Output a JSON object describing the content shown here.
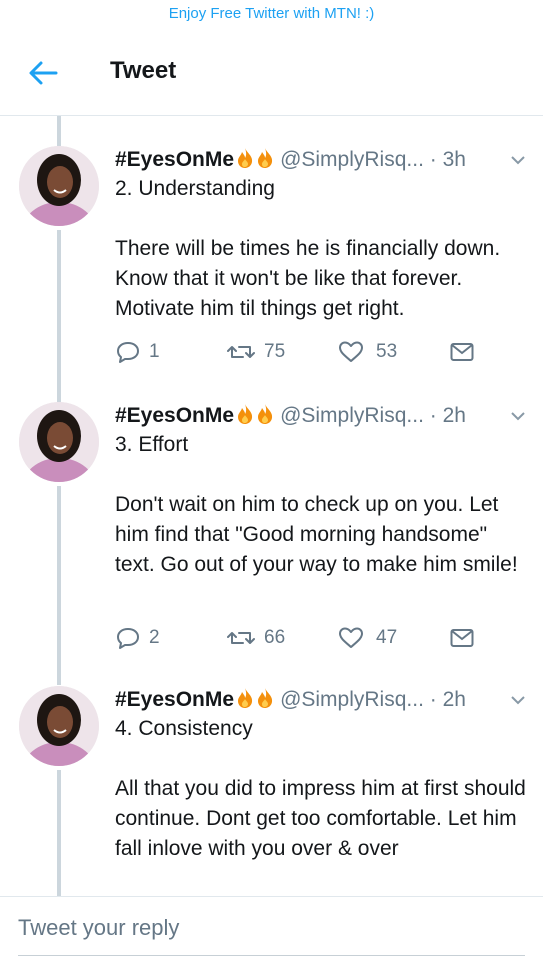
{
  "banner": {
    "text": "Enjoy Free Twitter with MTN! :)"
  },
  "header": {
    "title": "Tweet",
    "back_icon": "arrow-left-icon"
  },
  "colors": {
    "accent": "#1da1f2",
    "muted": "#657786",
    "thread_line": "#ccd6dd",
    "fire": "#f4900c"
  },
  "tweets": [
    {
      "name": "#EyesOnMe",
      "emoji_icons": [
        "fire-icon",
        "fire-icon"
      ],
      "handle": "@SimplyRisq...",
      "time": "· 3h",
      "title_line": "2. Understanding",
      "body": "There will be times he is financially down. Know that it won't be like that forever. Motivate him til things get right.",
      "replies": "1",
      "retweets": "75",
      "likes": "53"
    },
    {
      "name": "#EyesOnMe",
      "emoji_icons": [
        "fire-icon",
        "fire-icon"
      ],
      "handle": "@SimplyRisq...",
      "time": "· 2h",
      "title_line": "3. Effort",
      "body": "Don't wait on him to check up on you. Let him find that \"Good morning handsome\" text. Go out of your way to make him smile!",
      "replies": "2",
      "retweets": "66",
      "likes": "47"
    },
    {
      "name": "#EyesOnMe",
      "emoji_icons": [
        "fire-icon",
        "fire-icon"
      ],
      "handle": "@SimplyRisq...",
      "time": "· 2h",
      "title_line": "4. Consistency",
      "body": "All that you did to impress him at first should continue. Dont get too comfortable. Let him fall inlove with you over & over"
    }
  ],
  "reply_bar": {
    "placeholder": "Tweet your reply"
  }
}
